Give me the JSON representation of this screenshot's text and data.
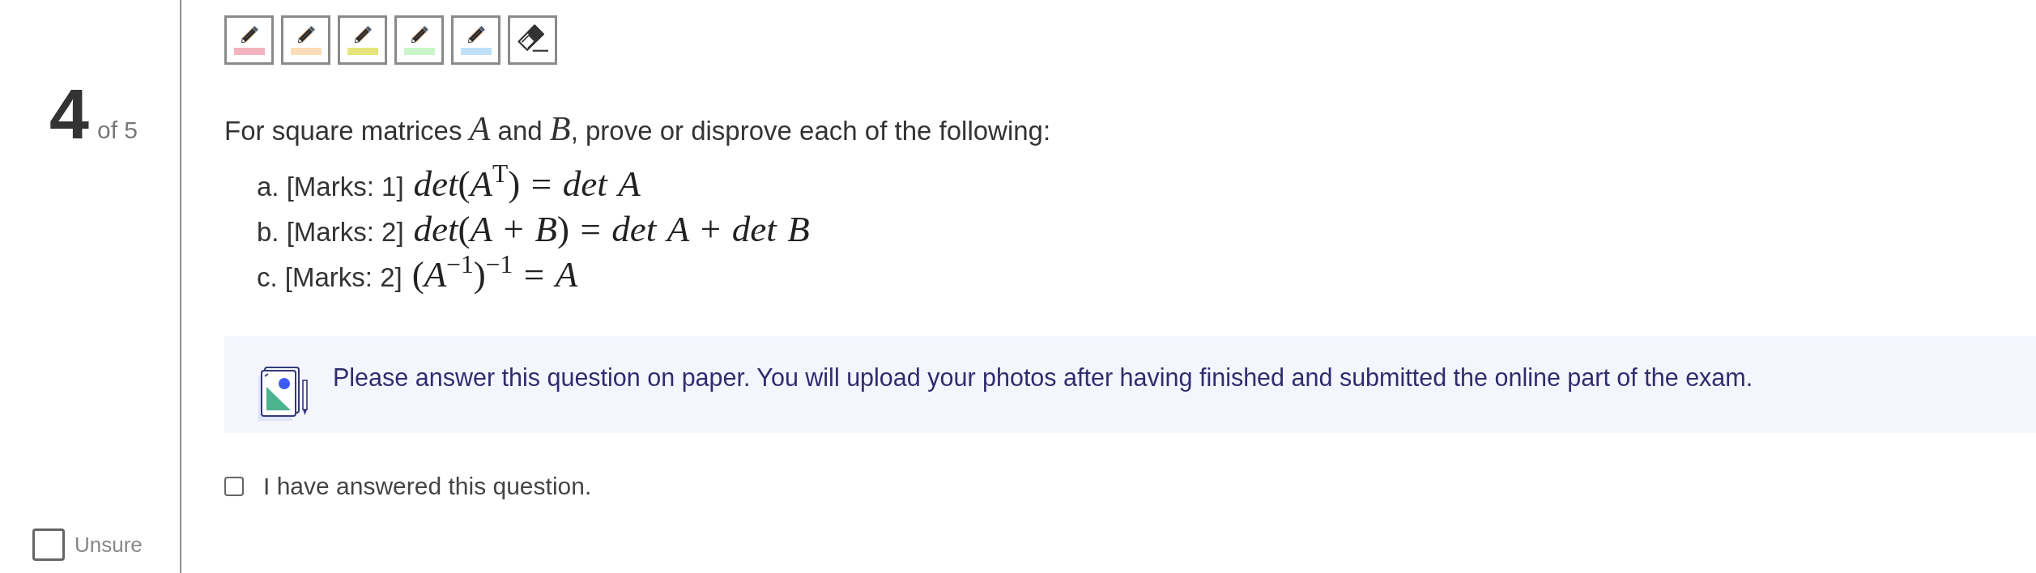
{
  "highlight_tools": [
    {
      "kind": "highlighter",
      "color": "#f4b4bd"
    },
    {
      "kind": "highlighter",
      "color": "#fcdcb9"
    },
    {
      "kind": "highlighter",
      "color": "#e6e47c"
    },
    {
      "kind": "highlighter",
      "color": "#c8f6c8"
    },
    {
      "kind": "highlighter",
      "color": "#c0e0f9"
    },
    {
      "kind": "eraser"
    }
  ],
  "question_nav": {
    "number": "4",
    "total": "of 5",
    "unsure": {
      "label": "Unsure",
      "checked": false
    }
  },
  "question": {
    "prompt": "For square matrices *A* and *B*, prove or disprove each of the following:",
    "parts": [
      {
        "label": "a. [Marks: 1]",
        "formula": "*det*(*A*$^{T}$) = *det* *A*"
      },
      {
        "label": "b. [Marks: 2]",
        "formula": "*det*(*A* + *B*) = *det* *A* + *det* *B*"
      },
      {
        "label": "c. [Marks: 2]",
        "formula": "(*A*$^{−1}$)$^{−1}$ = *A*"
      }
    ]
  },
  "notice": {
    "text": "Please answer this question on paper. You will upload your photos after having finished and submitted the online part of the exam."
  },
  "answered": {
    "label": "I have answered this question.",
    "checked": false
  }
}
